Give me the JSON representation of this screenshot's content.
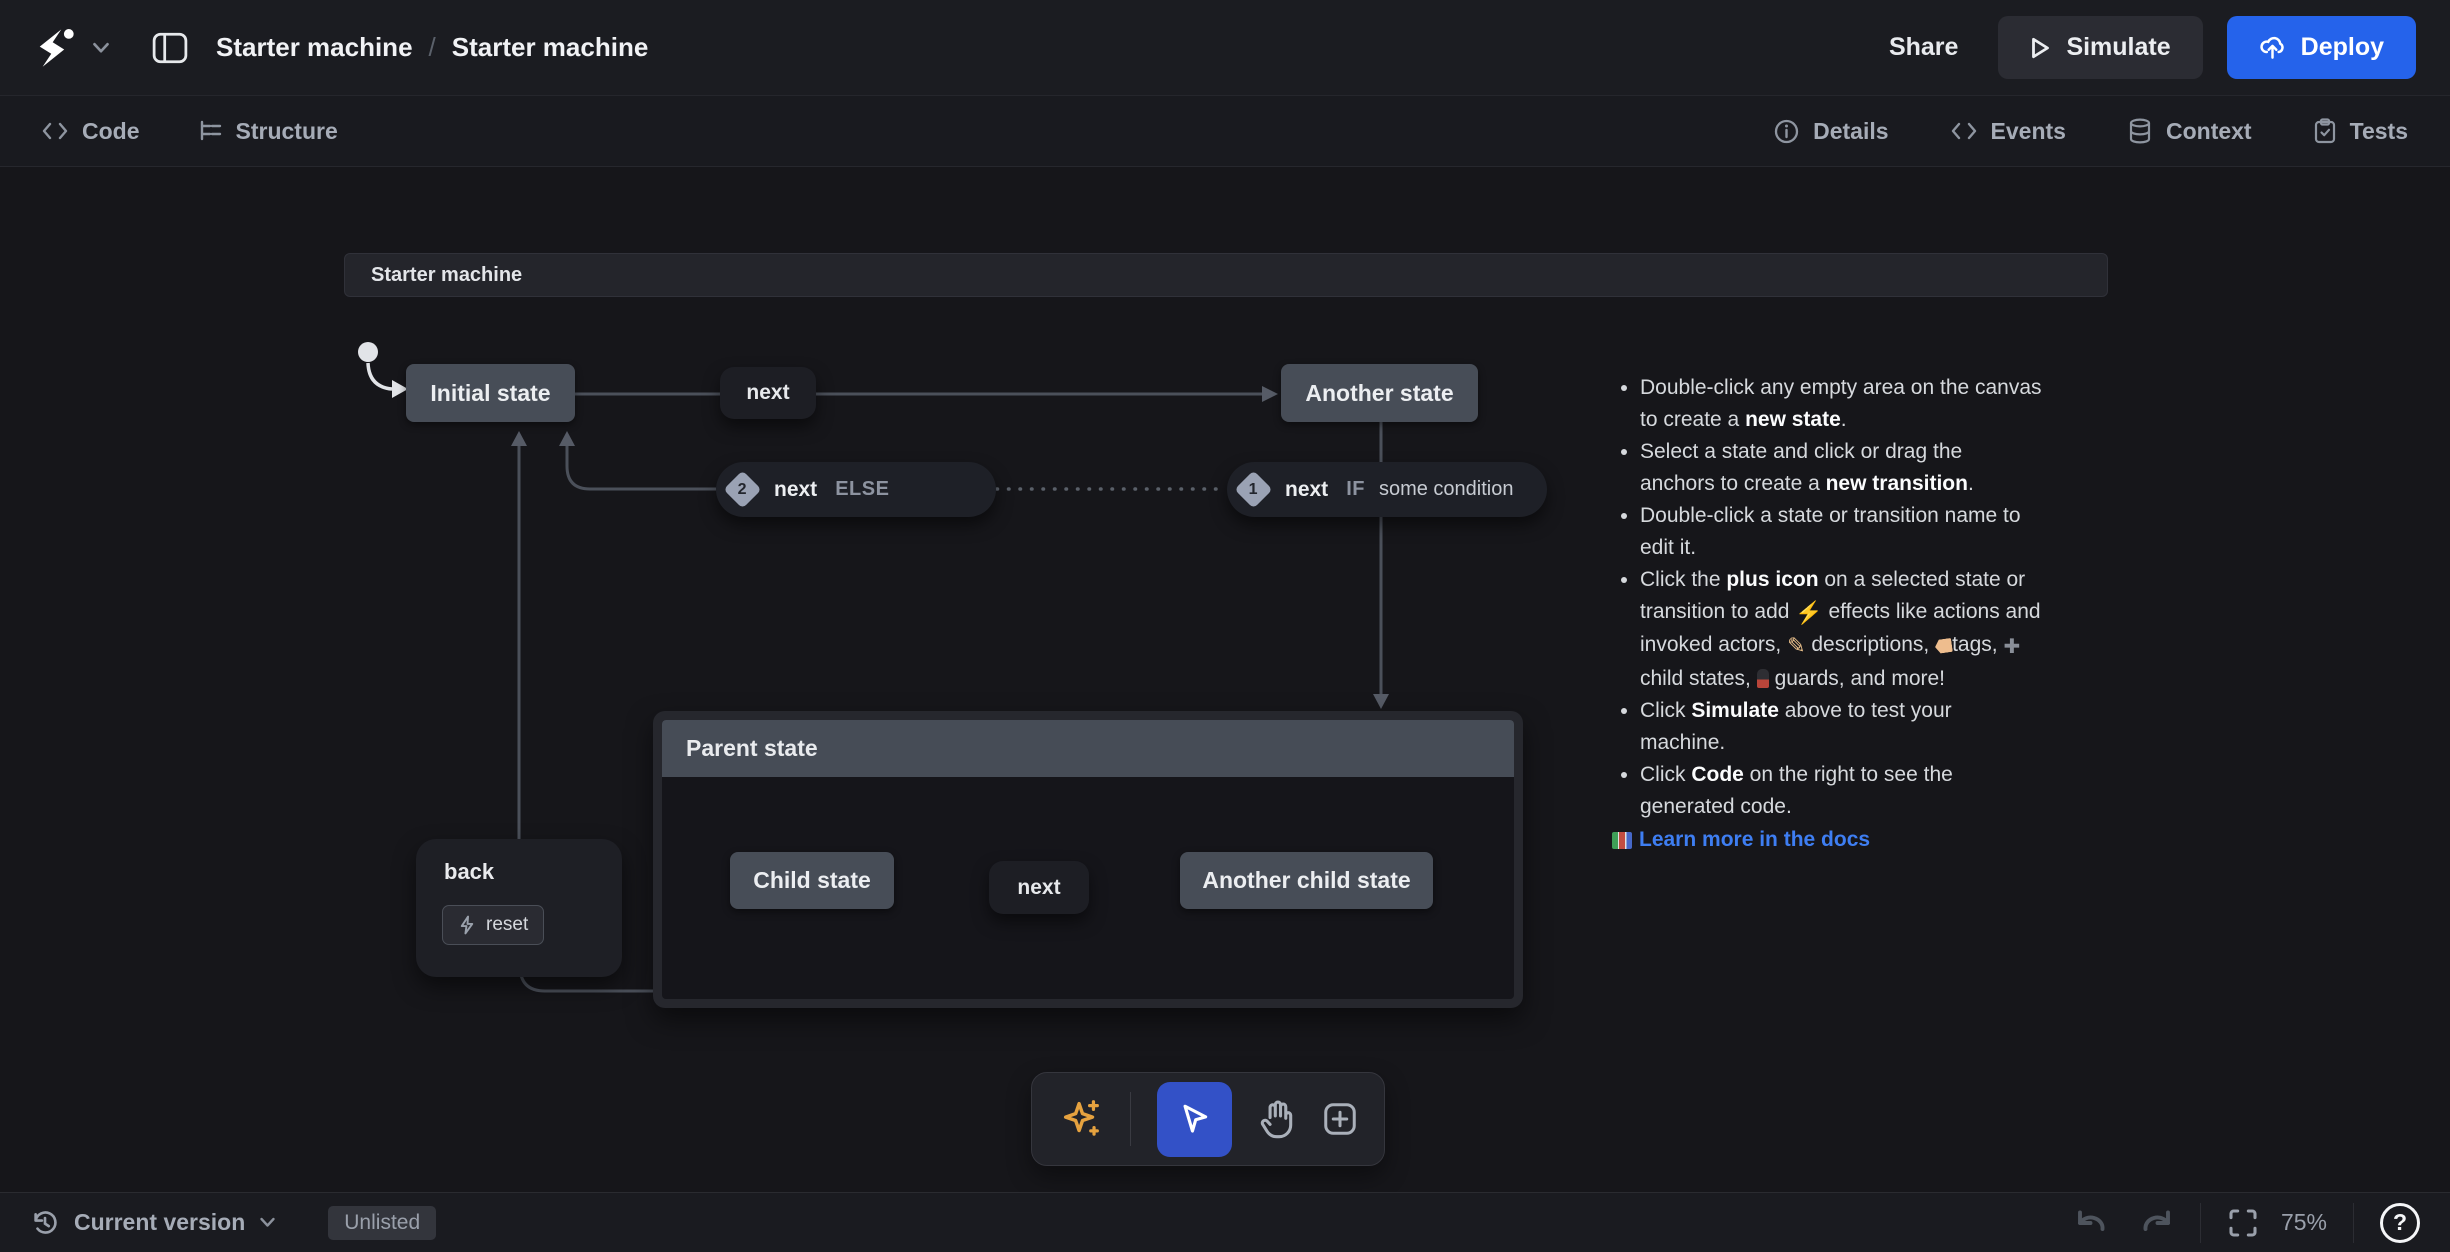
{
  "header": {
    "breadcrumb_project": "Starter machine",
    "breadcrumb_machine": "Starter machine",
    "breadcrumb_separator": "/",
    "share_label": "Share",
    "simulate_label": "Simulate",
    "deploy_label": "Deploy"
  },
  "mode_bar": {
    "left": [
      {
        "icon": "code-icon",
        "label": "Code"
      },
      {
        "icon": "structure-icon",
        "label": "Structure"
      }
    ],
    "right": [
      {
        "icon": "info-icon",
        "label": "Details"
      },
      {
        "icon": "code-icon",
        "label": "Events"
      },
      {
        "icon": "database-icon",
        "label": "Context"
      },
      {
        "icon": "clipboard-check-icon",
        "label": "Tests"
      }
    ]
  },
  "canvas": {
    "machine_title": "Starter machine",
    "states": {
      "initial": "Initial state",
      "another": "Another state",
      "parent": "Parent state",
      "child": "Child state",
      "another_child": "Another child state"
    },
    "transitions": {
      "next1": "next",
      "child_next": "next",
      "else_branch": {
        "order": "2",
        "event": "next",
        "keyword": "ELSE"
      },
      "if_branch": {
        "order": "1",
        "event": "next",
        "keyword": "IF",
        "condition": "some condition"
      },
      "back": {
        "name": "back",
        "action": "reset"
      }
    }
  },
  "help_panel": {
    "items": [
      "Double-click any empty area on the canvas to create a **new state**.",
      "Select a state and click or drag the anchors to create a **new transition**.",
      "Double-click a state or transition name to edit it.",
      "Click the **plus icon** on a selected state or transition to add {zap} effects like actions and invoked actors, {pen} descriptions, {tag}tags, {plus} child states, {guard} guards, and more!",
      "Click **Simulate** above to test your machine.",
      "Click **Code** on the right to see the generated code."
    ],
    "link_label": "Learn more in the docs"
  },
  "tools": {
    "items": [
      "ai-sparkles",
      "select",
      "pan",
      "add-state"
    ],
    "selected": "select"
  },
  "footer": {
    "version_label": "Current version",
    "visibility_badge": "Unlisted",
    "zoom_level": "75%",
    "help_label": "?"
  },
  "colors": {
    "deploy_blue": "#2563eb",
    "selected_tool_blue": "#3351c7",
    "sparkle_orange": "#e6a23f",
    "link_blue": "#3e7ef2",
    "state_gray": "#474d57",
    "wire_gray": "#4b505a"
  }
}
